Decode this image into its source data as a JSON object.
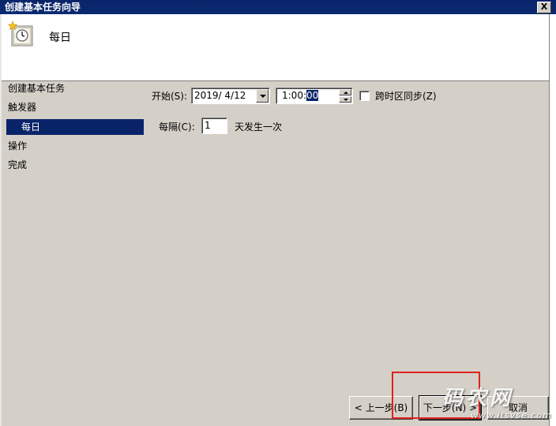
{
  "window": {
    "title": "创建基本任务向导",
    "close_label": "X"
  },
  "header": {
    "title": "每日",
    "icon": "task-clock-icon"
  },
  "nav": {
    "items": [
      {
        "label": "创建基本任务"
      },
      {
        "label": "触发器"
      },
      {
        "label": "每日"
      },
      {
        "label": "操作"
      },
      {
        "label": "完成"
      }
    ]
  },
  "form": {
    "start_label": "开始(S):",
    "date_value": "2019/ 4/12",
    "time_value_prefix": "1:00:",
    "time_value_selected": "00",
    "sync_timezone_label": "跨时区同步(Z)",
    "sync_timezone_checked": false,
    "recur_label": "每隔(C):",
    "recur_value": "1",
    "recur_suffix": "天发生一次"
  },
  "buttons": {
    "back": "< 上一步(B)",
    "next": "下一步(N) >",
    "cancel": "取消"
  },
  "watermark": {
    "text": "码农网",
    "url": "www.itsvse.com"
  }
}
